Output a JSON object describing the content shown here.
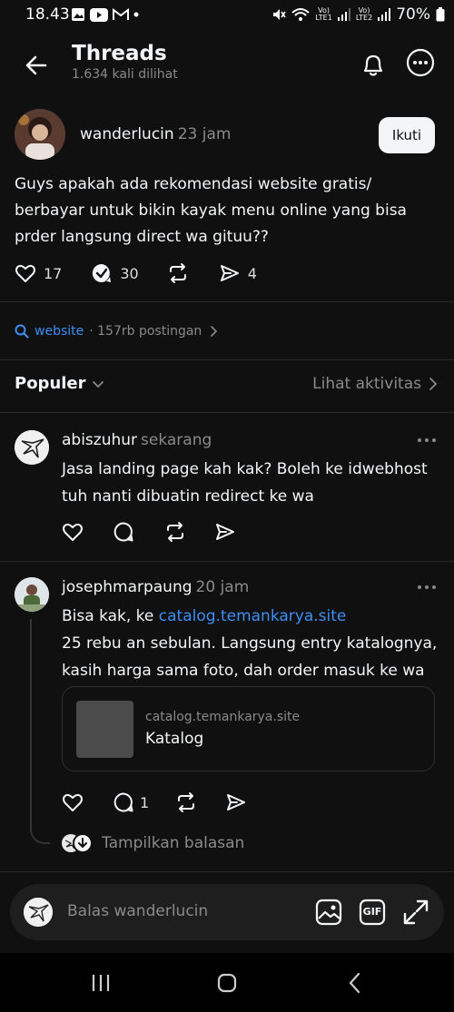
{
  "status_bar": {
    "time": "18.43",
    "battery": "70%",
    "sim1_label": "LTE1",
    "sim2_label": "LTE2"
  },
  "header": {
    "title": "Threads",
    "subtitle": "1.634 kali dilihat"
  },
  "post": {
    "username": "wanderlucin",
    "time": "23 jam",
    "follow_label": "Ikuti",
    "text": "Guys apakah ada rekomendasi website gratis/ berbayar untuk bikin kayak menu online yang bisa prder langsung direct wa gituu??",
    "likes": "17",
    "replies": "30",
    "shares": "4"
  },
  "topic": {
    "name": "website",
    "meta": "· 157rb postingan"
  },
  "sort": {
    "label": "Populer",
    "activity_label": "Lihat aktivitas"
  },
  "replies": [
    {
      "username": "abiszuhur",
      "time": "sekarang",
      "text": "Jasa landing page kah kak? Boleh ke idwebhost tuh nanti dibuatin redirect ke wa"
    },
    {
      "username": "josephmarpaung",
      "time": "20 jam",
      "text_prefix": "Bisa kak, ke ",
      "link": "catalog.temankarya.site",
      "text_rest": "25 rebu an sebulan. Langsung entry katalognya, kasih harga sama foto, dah order masuk ke wa",
      "card_domain": "catalog.temankarya.site",
      "card_title": "Katalog",
      "reply_count": "1"
    }
  ],
  "show_replies_label": "Tampilkan balasan",
  "composer": {
    "placeholder": "Balas wanderlucin",
    "gif_label": "GIF"
  },
  "colors": {
    "background": "#101010",
    "link": "#3d8ef5",
    "muted": "#8a8a8a"
  }
}
